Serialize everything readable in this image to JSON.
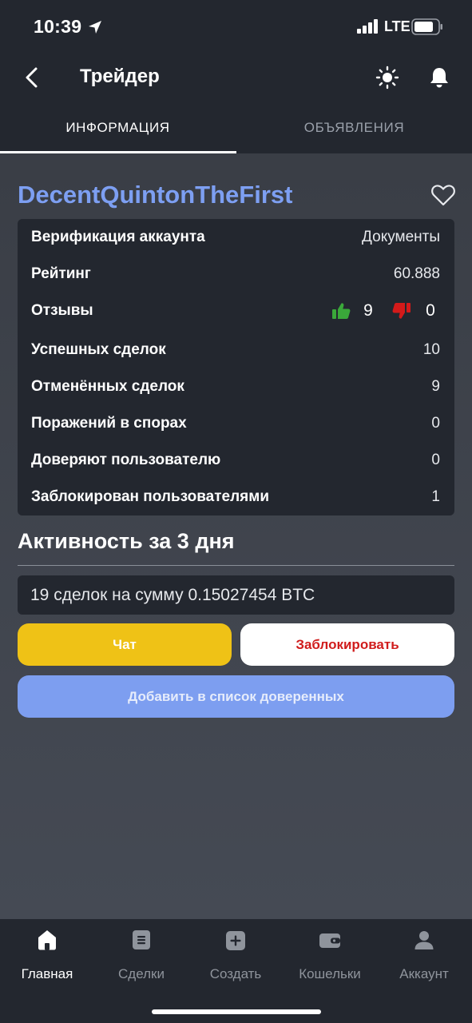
{
  "status_bar": {
    "time": "10:39",
    "network": "LTE"
  },
  "header": {
    "title": "Трейдер"
  },
  "tabs": [
    {
      "label": "ИНФОРМАЦИЯ",
      "active": true
    },
    {
      "label": "ОБЪЯВЛЕНИЯ",
      "active": false
    }
  ],
  "trader": {
    "name": "DecentQuintonTheFirst"
  },
  "info": {
    "verification": {
      "label": "Верификация аккаунта",
      "value": "Документы"
    },
    "rating": {
      "label": "Рейтинг",
      "value": "60.888"
    },
    "reviews": {
      "label": "Отзывы",
      "positive": "9",
      "negative": "0"
    },
    "successful": {
      "label": "Успешных сделок",
      "value": "10"
    },
    "cancelled": {
      "label": "Отменённых сделок",
      "value": "9"
    },
    "disputes_lost": {
      "label": "Поражений в спорах",
      "value": "0"
    },
    "trusted_by": {
      "label": "Доверяют пользователю",
      "value": "0"
    },
    "blocked_by": {
      "label": "Заблокирован пользователями",
      "value": "1"
    }
  },
  "activity": {
    "title": "Активность за 3 дня",
    "summary": "19 сделок на сумму 0.15027454 BTC"
  },
  "buttons": {
    "chat": "Чат",
    "block": "Заблокировать",
    "add_trusted": "Добавить в список доверенных"
  },
  "bottom_nav": [
    {
      "label": "Главная",
      "icon": "home-icon",
      "active": true
    },
    {
      "label": "Сделки",
      "icon": "deals-icon",
      "active": false
    },
    {
      "label": "Создать",
      "icon": "create-icon",
      "active": false
    },
    {
      "label": "Кошельки",
      "icon": "wallet-icon",
      "active": false
    },
    {
      "label": "Аккаунт",
      "icon": "account-icon",
      "active": false
    }
  ],
  "colors": {
    "header_bg": "#23272f",
    "content_bg": "#434852",
    "trader_name": "#7d9ff2",
    "chat_button": "#efc216",
    "block_text": "#d01c1c",
    "trust_button": "#7d9ef0",
    "thumb_up": "#3aa83a",
    "thumb_down": "#d41a1a"
  }
}
